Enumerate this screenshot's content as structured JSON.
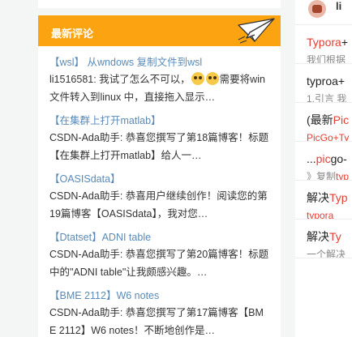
{
  "comments": {
    "title": "最新评论",
    "items": [
      {
        "title": "【wsl】 从wndows 复制文件到wsl",
        "body_a": "li1516581: 我试了怎么不可以，",
        "body_b": "需要将win 文件转入到linux 中，直接拖入显示…"
      },
      {
        "title": "【在集群上打开matlab】",
        "body": "CSDN-Ada助手: 恭喜您撰写了第18篇博客！标题【在集群上打开matlab】给人一…"
      },
      {
        "title": "【OASISdata】",
        "body": "CSDN-Ada助手: 恭喜用户继续创作！阅读您的第19篇博客【OASISdata】，我对您…"
      },
      {
        "title": "【Dtatset】ADNI table",
        "body": "CSDN-Ada助手: 恭喜您撰写了第20篇博客！标题中的\"ADNI table\"让我颇感兴趣。…"
      },
      {
        "title": "【BME 2112】W6 notes",
        "body": "CSDN-Ada助手: 恭喜您撰写了第17篇博客【BME 2112】W6 notes！不断地创作是…"
      }
    ]
  },
  "right": {
    "header_text": "li",
    "items": [
      {
        "title_hl": "Typora",
        "title_rest": "+",
        "sub_hl": "",
        "sub_rest": "我们根据"
      },
      {
        "title_hl": "",
        "title_rest": "typroa+",
        "sub_hl": "",
        "sub_rest": "1.引言 我"
      },
      {
        "title_pre": "(最新",
        "title_hl": "Pic",
        "title_rest": "",
        "sub_hl": "PicGo+Ty",
        "sub_rest": ""
      },
      {
        "title_pre": "...",
        "title_hl": "pic",
        "title_rest": "go-",
        "sub_pre": "》复制",
        "sub_hl": "typ",
        "sub_rest": ""
      },
      {
        "title_pre": "解决",
        "title_hl": "Typ",
        "title_rest": "",
        "sub_hl": "typora",
        "sub_rest": ""
      },
      {
        "title_pre": "解决",
        "title_hl": "Ty",
        "title_rest": "",
        "sub_hl": "",
        "sub_rest": "一个解决"
      }
    ]
  },
  "colors": {
    "header_orange": "#fca311",
    "link_blue": "#5a8ab8",
    "highlight_red": "#e33e33"
  },
  "icons": {
    "header": "paper-plane-icon",
    "emoji": "grin-emoji-icon"
  }
}
